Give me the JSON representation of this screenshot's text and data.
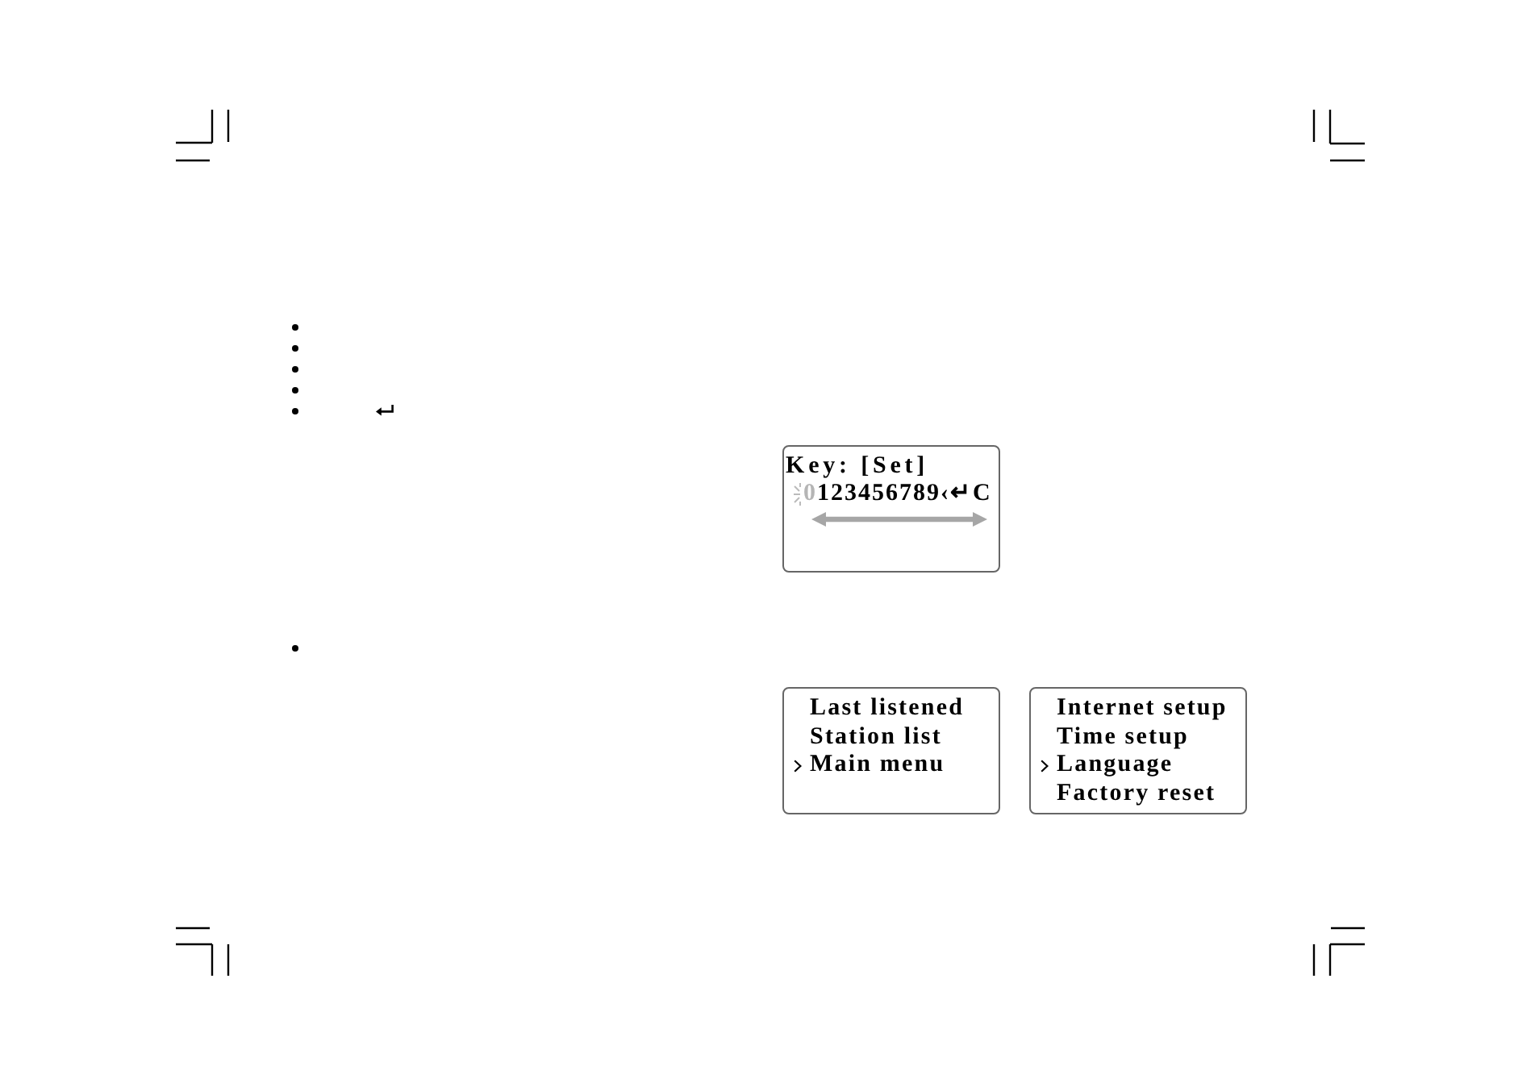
{
  "bullet_list_1": [
    {
      "kind": "plain"
    },
    {
      "kind": "plain"
    },
    {
      "kind": "plain"
    },
    {
      "kind": "plain"
    },
    {
      "kind": "with_return_icon"
    }
  ],
  "key_entry_screen": {
    "title": "Key: [Set]",
    "keys": [
      {
        "label": "0",
        "selected": true
      },
      {
        "label": "1",
        "selected": false
      },
      {
        "label": "2",
        "selected": false
      },
      {
        "label": "3",
        "selected": false
      },
      {
        "label": "4",
        "selected": false
      },
      {
        "label": "5",
        "selected": false
      },
      {
        "label": "6",
        "selected": false
      },
      {
        "label": "7",
        "selected": false
      },
      {
        "label": "8",
        "selected": false
      },
      {
        "label": "9",
        "selected": false
      },
      {
        "label": "‹",
        "selected": false
      },
      {
        "label": "↵",
        "selected": false
      },
      {
        "label": "C",
        "selected": false
      }
    ]
  },
  "bullet_list_2": [
    {
      "kind": "plain"
    }
  ],
  "menu_screens": [
    {
      "items": [
        {
          "label": "Last listened",
          "selected": false
        },
        {
          "label": "Station list",
          "selected": false
        },
        {
          "label": "Main menu",
          "selected": true
        }
      ]
    },
    {
      "items": [
        {
          "label": "Internet setup",
          "selected": false
        },
        {
          "label": "Time setup",
          "selected": false
        },
        {
          "label": "Language",
          "selected": true
        },
        {
          "label": "Factory reset",
          "selected": false
        }
      ]
    }
  ]
}
